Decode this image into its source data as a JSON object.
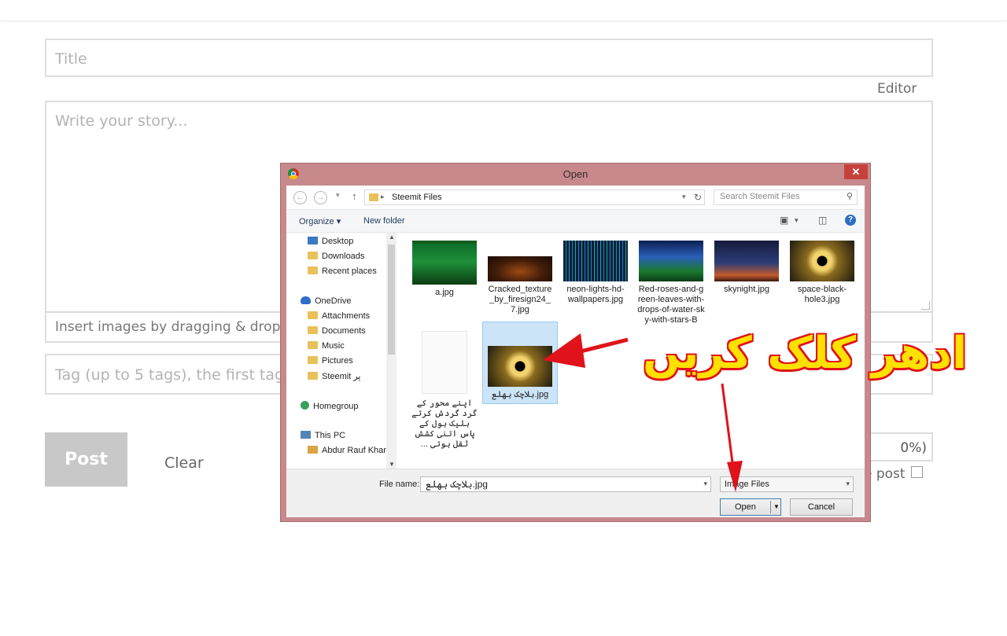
{
  "editor": {
    "title_placeholder": "Title",
    "editor_link": "Editor",
    "story_placeholder": "Write your story...",
    "drop_hint": "Insert images by dragging & dropping",
    "tags_placeholder": "Tag (up to 5 tags), the first tag is",
    "post_label": "Post",
    "clear_label": "Clear",
    "reward_partial": "0%)",
    "upvote_partial": "e post"
  },
  "dialog": {
    "title": "Open",
    "close": "✕",
    "address": "Steemit Files",
    "search_placeholder": "Search Steemit Files",
    "toolbar": {
      "organize": "Organize ▾",
      "new_folder": "New folder"
    },
    "nav_items": [
      {
        "label": "Desktop",
        "icon": "desktop-icon"
      },
      {
        "label": "Downloads",
        "icon": "folder-icon"
      },
      {
        "label": "Recent places",
        "icon": "folder-icon"
      },
      {
        "label": "OneDrive",
        "icon": "cloud-icon"
      },
      {
        "label": "Attachments",
        "icon": "folder-icon"
      },
      {
        "label": "Documents",
        "icon": "folder-icon"
      },
      {
        "label": "Music",
        "icon": "folder-icon"
      },
      {
        "label": "Pictures",
        "icon": "folder-icon"
      },
      {
        "label": "Steemit پر",
        "icon": "folder-icon"
      },
      {
        "label": "Homegroup",
        "icon": "homegroup-icon"
      },
      {
        "label": "This PC",
        "icon": "pc-icon"
      },
      {
        "label": "Abdur Rauf Khan",
        "icon": "user-icon"
      }
    ],
    "files": [
      {
        "name": "a.jpg"
      },
      {
        "name": "Cracked_texture_by_firesign24_7.jpg"
      },
      {
        "name": "neon-lights-hd-wallpapers.jpg"
      },
      {
        "name": "Red-roses-and-green-leaves-with-drops-of-water-sky-with-stars-B"
      },
      {
        "name": "skynight.jpg"
      },
      {
        "name": "space-black-hole3.jpg"
      },
      {
        "name": "اپنے محور کے گرد گردش کرتے بلیک ہول کے پاس اتنی کشش ثقل ہوتی ..."
      },
      {
        "name": "بلاچک ہھلع.jpg"
      }
    ],
    "file_name_label": "File name:",
    "file_name_value": "بلاچک ہھلع.jpg",
    "file_type": "Image Files",
    "open_label": "Open",
    "cancel_label": "Cancel"
  },
  "annotation": {
    "text": "ادھر کلک کریں",
    "color": "#ffe100",
    "outline": "#e0121b"
  }
}
